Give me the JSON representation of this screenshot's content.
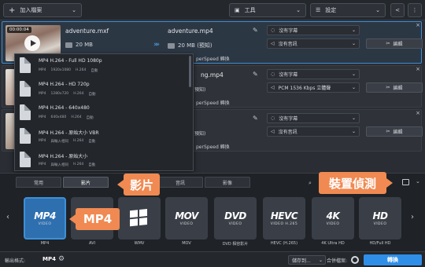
{
  "toolbar": {
    "add_file": "加入檔案",
    "tools": "工具",
    "settings": "設定"
  },
  "files": [
    {
      "time": "00:00:04",
      "src_name": "adventure.mxf",
      "src_size": "20 MB",
      "dst_name": "adventure.mp4",
      "dst_size": "20 MB (預知)",
      "subtitle": "沒有字幕",
      "audio": "沒有音訊",
      "edit": "編輯"
    },
    {
      "dst_name_partial": "ng.mp4",
      "dst_size_partial": "預知)",
      "subtitle": "沒有字幕",
      "audio": "PCM 1536 Kbps 立體聲",
      "edit": "編輯",
      "superspeed": "perSpeed 轉換"
    },
    {
      "dst_size_partial": "預知)",
      "subtitle": "沒有字幕",
      "audio": "沒有音訊",
      "edit": "編輯",
      "superspeed": "perSpeed 轉換"
    }
  ],
  "superspeed_first": "perSpeed 轉換",
  "dropdown": [
    {
      "title": "MP4 H.264 - Full HD 1080p",
      "meta": [
        "MP4",
        "1920x1080",
        "H.264",
        "自動"
      ]
    },
    {
      "title": "MP4 H.264 - HD 720p",
      "meta": [
        "MP4",
        "1280x720",
        "H.264",
        "自動"
      ]
    },
    {
      "title": "MP4 H.264 - 640x480",
      "meta": [
        "MP4",
        "640x480",
        "H.264",
        "自動"
      ]
    },
    {
      "title": "MP4 H.264 - 原始大小 VBR",
      "meta": [
        "MP4",
        "與輸入相同",
        "H.264",
        "自動"
      ]
    },
    {
      "title": "MP4 H.264 - 原始大小",
      "meta": [
        "MP4",
        "與輸入相同",
        "H.264",
        "自動"
      ]
    }
  ],
  "tabs": [
    "常用",
    "影片",
    "音訊",
    "影像"
  ],
  "formats": [
    {
      "big": "MP4",
      "sub": "VIDEO",
      "label": "MP4"
    },
    {
      "big": "",
      "sub": "",
      "label": "AVI"
    },
    {
      "big": "",
      "sub": "",
      "label": "WMV"
    },
    {
      "big": "MOV",
      "sub": "VIDEO",
      "label": "MOV"
    },
    {
      "big": "DVD",
      "sub": "VIDEO",
      "label": "DVD 相容影片"
    },
    {
      "big": "HEVC",
      "sub": "VIDEO H.265",
      "label": "HEVC (H.265)"
    },
    {
      "big": "4K",
      "sub": "VIDEO",
      "label": "4K Ultra HD"
    },
    {
      "big": "HD",
      "sub": "VIDEO",
      "label": "HD/Full HD"
    }
  ],
  "callouts": {
    "video": "影片",
    "detect": "裝置偵測",
    "mp4": "MP4"
  },
  "bottom": {
    "output_label": "輸出格式:",
    "output_value": "MP4",
    "save_to": "儲存到...",
    "merge": "合併檔案:",
    "convert": "轉換"
  },
  "colors": {
    "accent": "#3d8fd6",
    "convert": "#2f8fe8",
    "callout": "#f08a52"
  }
}
